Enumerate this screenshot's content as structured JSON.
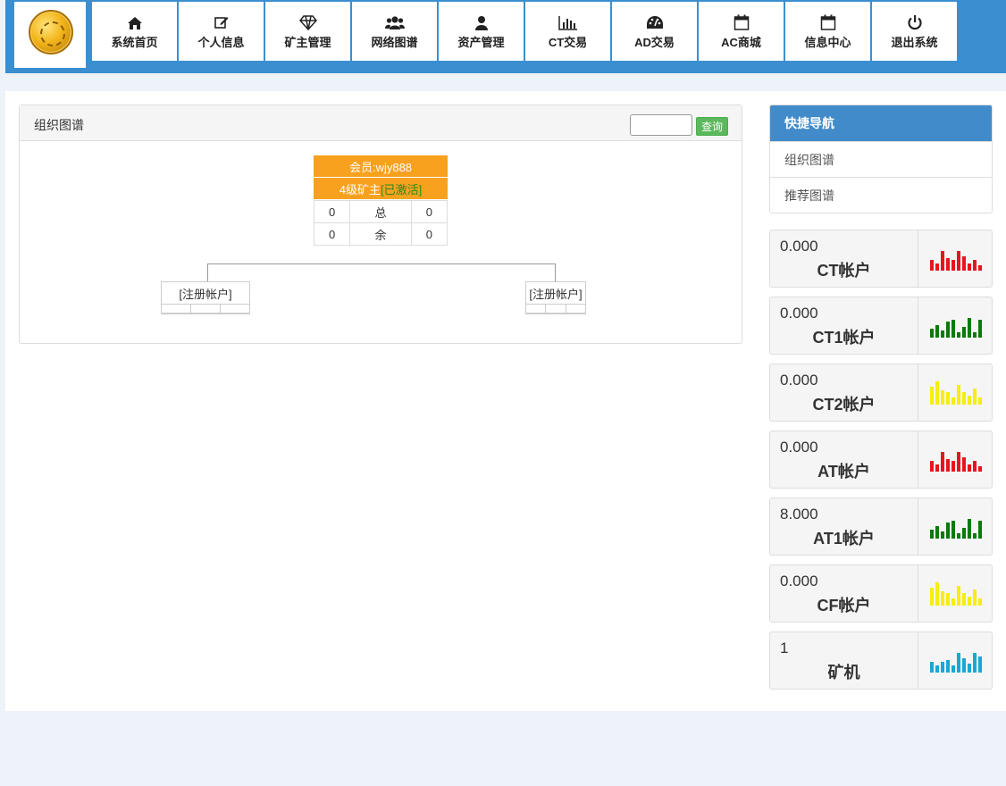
{
  "nav": [
    {
      "id": "home",
      "label": "系统首页",
      "icon": "home-icon"
    },
    {
      "id": "profile",
      "label": "个人信息",
      "icon": "edit-icon"
    },
    {
      "id": "miner",
      "label": "矿主管理",
      "icon": "diamond-icon"
    },
    {
      "id": "network",
      "label": "网络图谱",
      "icon": "users-icon"
    },
    {
      "id": "assets",
      "label": "资产管理",
      "icon": "user-icon"
    },
    {
      "id": "ct",
      "label": "CT交易",
      "icon": "bar-chart-icon"
    },
    {
      "id": "ad",
      "label": "AD交易",
      "icon": "dashboard-icon"
    },
    {
      "id": "ac",
      "label": "AC商城",
      "icon": "calendar-icon"
    },
    {
      "id": "info",
      "label": "信息中心",
      "icon": "calendar-icon"
    },
    {
      "id": "logout",
      "label": "退出系统",
      "icon": "power-icon"
    }
  ],
  "org": {
    "title": "组织图谱",
    "search_button": "查询",
    "search_value": "",
    "root": {
      "member": "会员:wjy888",
      "level": "4级矿主 ",
      "status": "[已激活]",
      "rows": [
        {
          "left": "0",
          "mid": "总",
          "right": "0"
        },
        {
          "left": "0",
          "mid": "余",
          "right": "0"
        }
      ]
    },
    "children": [
      {
        "label": "[注册帐户]"
      },
      {
        "label": "[注册帐户]"
      }
    ]
  },
  "quick_nav": {
    "title": "快捷导航",
    "items": [
      "组织图谱",
      "推荐图谱"
    ]
  },
  "accounts": [
    {
      "value": "0.000",
      "name": "CT帐户",
      "color": "#e8141e",
      "bars": [
        12,
        8,
        22,
        14,
        12,
        22,
        16,
        8,
        12,
        6
      ]
    },
    {
      "value": "0.000",
      "name": "CT1帐户",
      "color": "#0a7a0a",
      "bars": [
        10,
        14,
        8,
        18,
        20,
        6,
        12,
        22,
        6,
        20
      ]
    },
    {
      "value": "0.000",
      "name": "CT2帐户",
      "color": "#f5ee10",
      "bars": [
        20,
        26,
        16,
        14,
        8,
        22,
        14,
        10,
        18,
        8
      ]
    },
    {
      "value": "0.000",
      "name": "AT帐户",
      "color": "#e8141e",
      "bars": [
        12,
        8,
        22,
        14,
        12,
        22,
        16,
        8,
        12,
        6
      ]
    },
    {
      "value": "8.000",
      "name": "AT1帐户",
      "color": "#0a7a0a",
      "bars": [
        10,
        14,
        8,
        18,
        20,
        6,
        12,
        22,
        6,
        20
      ]
    },
    {
      "value": "0.000",
      "name": "CF帐户",
      "color": "#f5ee10",
      "bars": [
        20,
        26,
        16,
        14,
        8,
        22,
        14,
        10,
        18,
        8
      ]
    },
    {
      "value": "1",
      "name": "矿机",
      "color": "#19a8d6",
      "bars": [
        12,
        8,
        12,
        14,
        8,
        22,
        16,
        10,
        22,
        18
      ]
    }
  ]
}
